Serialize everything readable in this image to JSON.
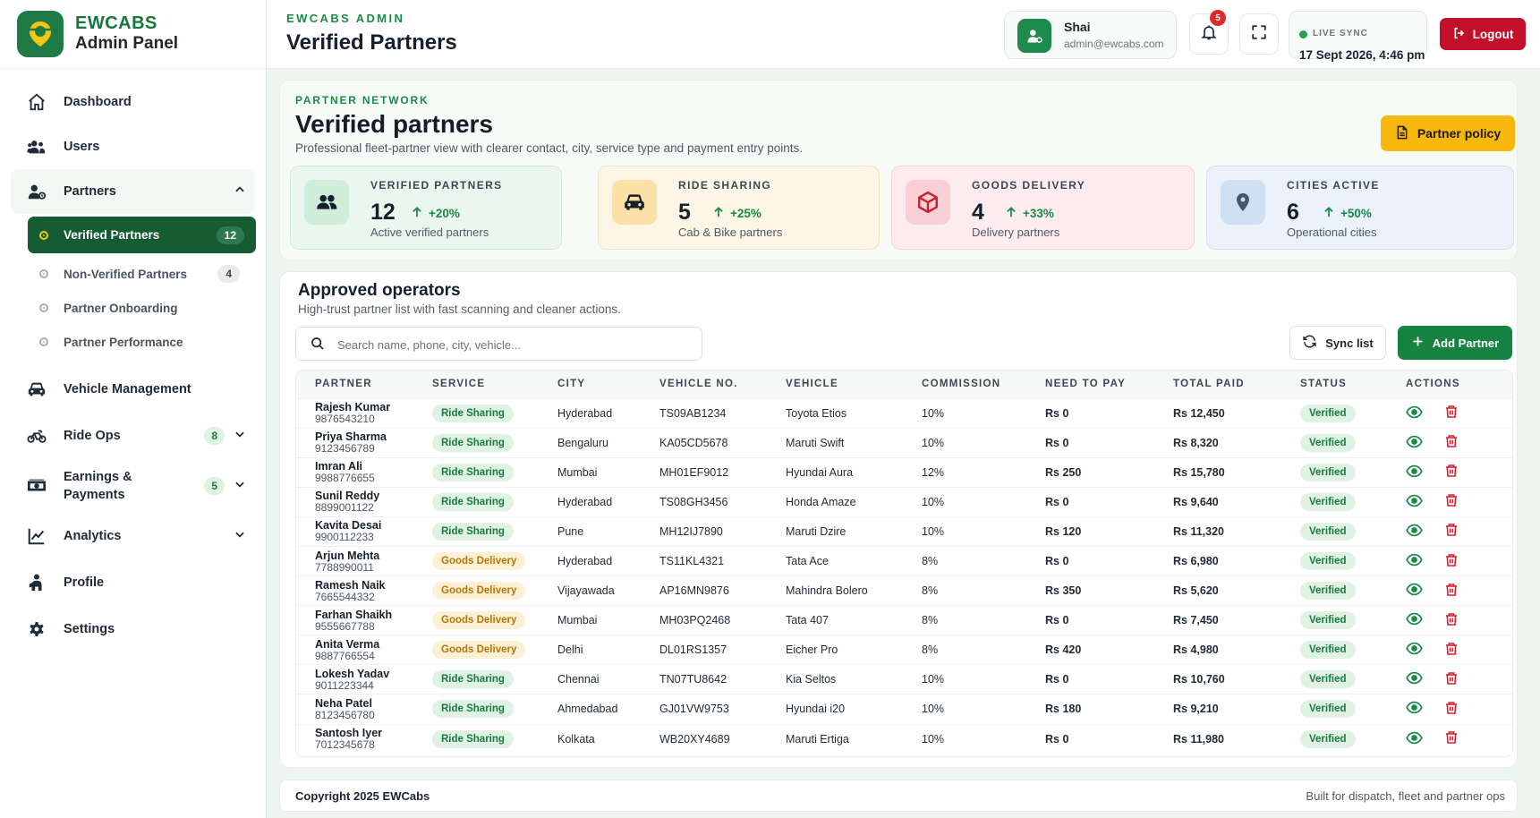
{
  "brand": {
    "name": "EWCABS",
    "subtitle": "Admin Panel"
  },
  "sidebar": {
    "items": [
      {
        "label": "Dashboard",
        "icon": "home-icon"
      },
      {
        "label": "Users",
        "icon": "users-icon"
      },
      {
        "label": "Partners",
        "icon": "partner-icon",
        "expanded": true
      }
    ],
    "partner_sub": [
      {
        "label": "Verified Partners",
        "count": "12",
        "active": true
      },
      {
        "label": "Non-Verified Partners",
        "count": "4"
      },
      {
        "label": "Partner Onboarding"
      },
      {
        "label": "Partner Performance"
      }
    ],
    "items2": [
      {
        "label": "Vehicle Management",
        "icon": "car-icon"
      },
      {
        "label": "Ride Ops",
        "icon": "bike-icon",
        "count": "8"
      },
      {
        "label": "Earnings & Payments",
        "icon": "money-icon",
        "count": "5"
      },
      {
        "label": "Analytics",
        "icon": "chart-icon"
      },
      {
        "label": "Profile",
        "icon": "profile-icon"
      },
      {
        "label": "Settings",
        "icon": "gear-icon"
      }
    ]
  },
  "header": {
    "kicker": "EWCABS ADMIN",
    "title": "Verified Partners",
    "user": {
      "name": "Shai",
      "email": "admin@ewcabs.com"
    },
    "notifications": "5",
    "sync_label": "LIVE SYNC",
    "sync_time": "17 Sept 2026, 4:46 pm",
    "logout": "Logout"
  },
  "banner": {
    "kicker": "PARTNER NETWORK",
    "title": "Verified partners",
    "description": "Professional fleet-partner view with clearer contact, city, service type and payment entry points.",
    "policy_button": "Partner policy"
  },
  "stats": [
    {
      "label": "VERIFIED PARTNERS",
      "value": "12",
      "trend": "+20%",
      "sub": "Active verified partners",
      "icon": "users-icon"
    },
    {
      "label": "RIDE SHARING",
      "value": "5",
      "trend": "+25%",
      "sub": "Cab & Bike partners",
      "icon": "car-icon"
    },
    {
      "label": "GOODS DELIVERY",
      "value": "4",
      "trend": "+33%",
      "sub": "Delivery partners",
      "icon": "box-icon"
    },
    {
      "label": "CITIES ACTIVE",
      "value": "6",
      "trend": "+50%",
      "sub": "Operational cities",
      "icon": "location-pin-icon"
    }
  ],
  "table_card": {
    "title": "Approved operators",
    "subtitle": "High-trust partner list with fast scanning and cleaner actions.",
    "search_placeholder": "Search name, phone, city, vehicle...",
    "sync_button": "Sync list",
    "add_button": "Add Partner",
    "columns": [
      "PARTNER",
      "SERVICE",
      "CITY",
      "VEHICLE NO.",
      "VEHICLE",
      "COMMISSION",
      "NEED TO PAY",
      "TOTAL PAID",
      "STATUS",
      "ACTIONS"
    ],
    "rows": [
      {
        "name": "Rajesh Kumar",
        "phone": "9876543210",
        "service": "Ride Sharing",
        "city": "Hyderabad",
        "vno": "TS09AB1234",
        "vehicle": "Toyota Etios",
        "commission": "10%",
        "need": "Rs 0",
        "paid": "Rs 12,450",
        "status": "Verified"
      },
      {
        "name": "Priya Sharma",
        "phone": "9123456789",
        "service": "Ride Sharing",
        "city": "Bengaluru",
        "vno": "KA05CD5678",
        "vehicle": "Maruti Swift",
        "commission": "10%",
        "need": "Rs 0",
        "paid": "Rs 8,320",
        "status": "Verified"
      },
      {
        "name": "Imran Ali",
        "phone": "9988776655",
        "service": "Ride Sharing",
        "city": "Mumbai",
        "vno": "MH01EF9012",
        "vehicle": "Hyundai Aura",
        "commission": "12%",
        "need": "Rs 250",
        "paid": "Rs 15,780",
        "status": "Verified"
      },
      {
        "name": "Sunil Reddy",
        "phone": "8899001122",
        "service": "Ride Sharing",
        "city": "Hyderabad",
        "vno": "TS08GH3456",
        "vehicle": "Honda Amaze",
        "commission": "10%",
        "need": "Rs 0",
        "paid": "Rs 9,640",
        "status": "Verified"
      },
      {
        "name": "Kavita Desai",
        "phone": "9900112233",
        "service": "Ride Sharing",
        "city": "Pune",
        "vno": "MH12IJ7890",
        "vehicle": "Maruti Dzire",
        "commission": "10%",
        "need": "Rs 120",
        "paid": "Rs 11,320",
        "status": "Verified"
      },
      {
        "name": "Arjun Mehta",
        "phone": "7788990011",
        "service": "Goods Delivery",
        "city": "Hyderabad",
        "vno": "TS11KL4321",
        "vehicle": "Tata Ace",
        "commission": "8%",
        "need": "Rs 0",
        "paid": "Rs 6,980",
        "status": "Verified"
      },
      {
        "name": "Ramesh Naik",
        "phone": "7665544332",
        "service": "Goods Delivery",
        "city": "Vijayawada",
        "vno": "AP16MN9876",
        "vehicle": "Mahindra Bolero",
        "commission": "8%",
        "need": "Rs 350",
        "paid": "Rs 5,620",
        "status": "Verified"
      },
      {
        "name": "Farhan Shaikh",
        "phone": "9555667788",
        "service": "Goods Delivery",
        "city": "Mumbai",
        "vno": "MH03PQ2468",
        "vehicle": "Tata 407",
        "commission": "8%",
        "need": "Rs 0",
        "paid": "Rs 7,450",
        "status": "Verified"
      },
      {
        "name": "Anita Verma",
        "phone": "9887766554",
        "service": "Goods Delivery",
        "city": "Delhi",
        "vno": "DL01RS1357",
        "vehicle": "Eicher Pro",
        "commission": "8%",
        "need": "Rs 420",
        "paid": "Rs 4,980",
        "status": "Verified"
      },
      {
        "name": "Lokesh Yadav",
        "phone": "9011223344",
        "service": "Ride Sharing",
        "city": "Chennai",
        "vno": "TN07TU8642",
        "vehicle": "Kia Seltos",
        "commission": "10%",
        "need": "Rs 0",
        "paid": "Rs 10,760",
        "status": "Verified"
      },
      {
        "name": "Neha Patel",
        "phone": "8123456780",
        "service": "Ride Sharing",
        "city": "Ahmedabad",
        "vno": "GJ01VW9753",
        "vehicle": "Hyundai i20",
        "commission": "10%",
        "need": "Rs 180",
        "paid": "Rs 9,210",
        "status": "Verified"
      },
      {
        "name": "Santosh Iyer",
        "phone": "7012345678",
        "service": "Ride Sharing",
        "city": "Kolkata",
        "vno": "WB20XY4689",
        "vehicle": "Maruti Ertiga",
        "commission": "10%",
        "need": "Rs 0",
        "paid": "Rs 11,980",
        "status": "Verified"
      }
    ]
  },
  "footer": {
    "left": "Copyright 2025 EWCabs",
    "right": "Built for dispatch, fleet and partner ops"
  },
  "colors": {
    "primary": "#168342",
    "dark_green": "#155c33",
    "accent_yellow": "#f7b70c",
    "danger": "#c2102b"
  }
}
